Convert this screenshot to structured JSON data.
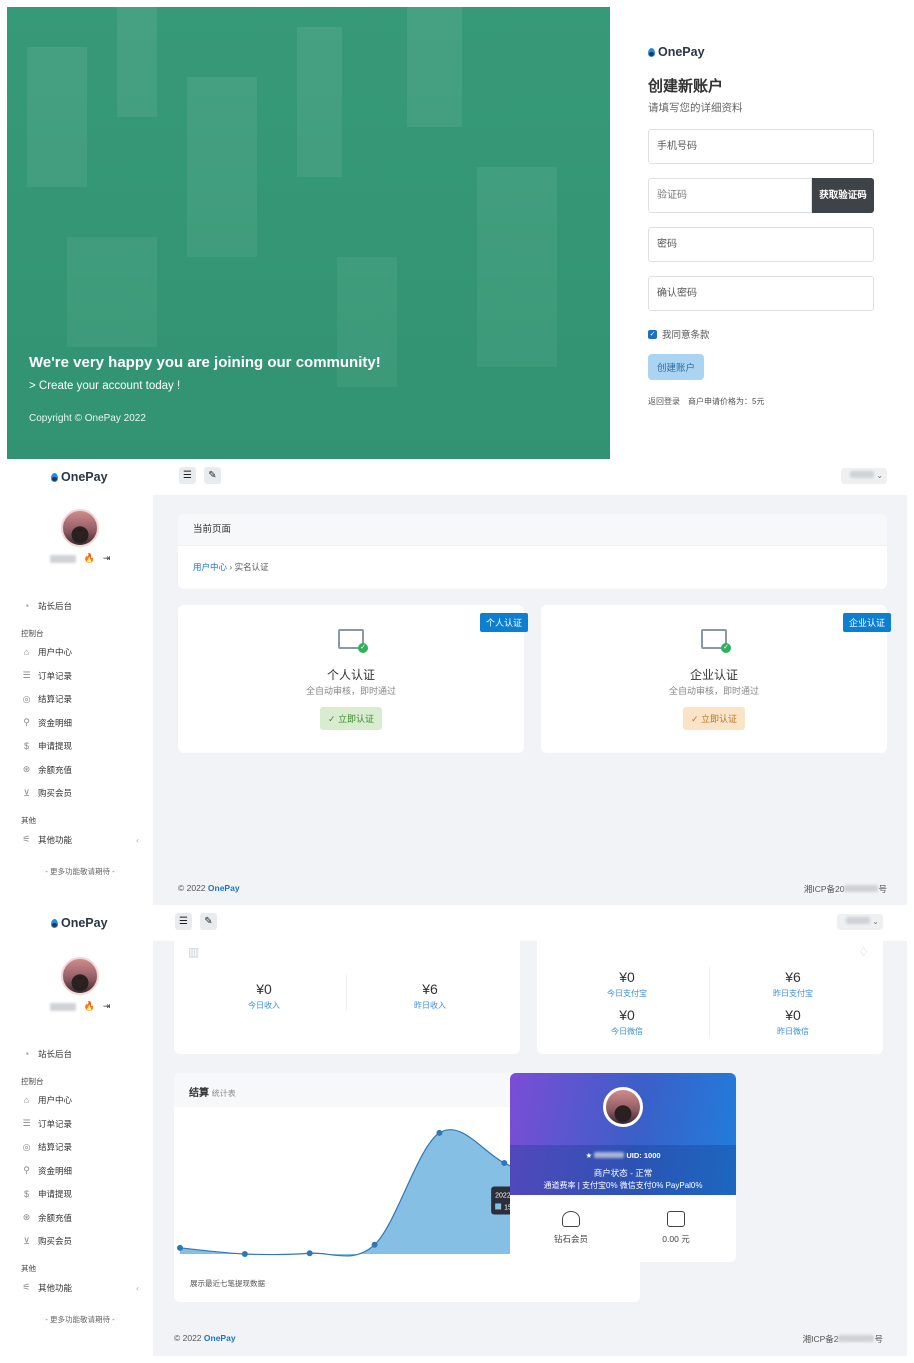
{
  "register": {
    "hero": {
      "title": "We're very happy you are joining our community!",
      "subtitle": "> Create your account today !",
      "copyright": "Copyright © OnePay 2022"
    },
    "logo": "OnePay",
    "heading": "创建新账户",
    "hint": "请填写您的详细资料",
    "phone_placeholder": "手机号码",
    "code_placeholder": "验证码",
    "get_code": "获取验证码",
    "password_placeholder": "密码",
    "confirm_placeholder": "确认密码",
    "agree": "我同意条款",
    "create": "创建账户",
    "back_login": "返回登录",
    "price_note": "商户申请价格为：5元"
  },
  "dashboard": {
    "logo": "OnePay",
    "menu_icon": "☰",
    "brush_icon": "✎",
    "sidebar": {
      "admin": "站长后台",
      "group_console": "控制台",
      "items": [
        "用户中心",
        "订单记录",
        "结算记录",
        "资金明细",
        "申请提现",
        "余额充值",
        "购买会员"
      ],
      "group_other": "其他",
      "other": "其他功能",
      "more": "- 更多功能敬请期待 -"
    },
    "page_header": "当前页面",
    "breadcrumb_parent": "用户中心",
    "breadcrumb_current": "实名认证",
    "personal": {
      "ribbon": "个人认证",
      "title": "个人认证",
      "desc": "全自动审核，即时通过",
      "button": "✓ 立即认证"
    },
    "company": {
      "ribbon": "企业认证",
      "title": "企业认证",
      "desc": "全自动审核，即时通过",
      "button": "✓ 立即认证"
    },
    "footer_left_prefix": "© 2022 ",
    "footer_brand": "OnePay",
    "footer_right": "湘ICP备20",
    "footer_right_end": "号"
  },
  "overview": {
    "today_income": {
      "value": "¥0",
      "label": "今日收入"
    },
    "yesterday_income": {
      "value": "¥6",
      "label": "昨日收入"
    },
    "today_alipay": {
      "value": "¥0",
      "label": "今日支付宝"
    },
    "yesterday_alipay": {
      "value": "¥6",
      "label": "昨日支付宝"
    },
    "today_wechat": {
      "value": "¥0",
      "label": "今日微信"
    },
    "yesterday_wechat": {
      "value": "¥0",
      "label": "昨日微信"
    },
    "chart_title": "结算",
    "chart_subtitle": "统计表",
    "chart_note": "展示最近七笔提现数据",
    "tooltip_time": "2022-10-18 17:30:50",
    "tooltip_value": "157 元",
    "profile": {
      "uid": "UID: 1000",
      "status": "商户状态 - 正常",
      "rates": "通道费率 | 支付宝0% 微信支付0% PayPal0%",
      "diamond": "钻石会员",
      "balance": "0.00 元"
    },
    "footer_right": "湘ICP备2",
    "footer_right_end": "号"
  },
  "chart_data": {
    "type": "area",
    "title": "结算",
    "subtitle": "统计表",
    "x": [
      "",
      "",
      "",
      "",
      "",
      "",
      ""
    ],
    "values": [
      8,
      0,
      1,
      12,
      157,
      118,
      72,
      0
    ],
    "ylim": [
      0,
      175
    ],
    "grid": false,
    "highlight": {
      "label": "2022-10-18 17:30:50",
      "value": 157
    }
  },
  "colors": {
    "hero": "#3b9e7d",
    "accent": "#1e74c8",
    "ribbon": "#0d7fd0",
    "dark_button": "#3e4349",
    "area": "#86bfe4"
  }
}
